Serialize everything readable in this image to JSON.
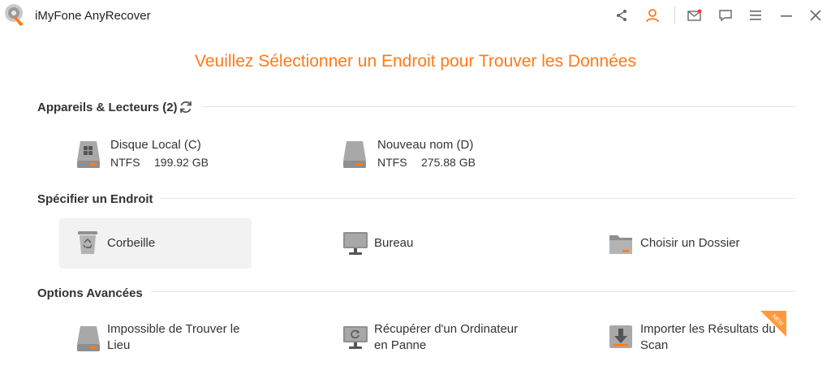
{
  "app": {
    "title": "iMyFone AnyRecover"
  },
  "headline": "Veuillez Sélectionner un Endroit pour Trouver les Données",
  "devices": {
    "title": "Appareils & Lecteurs (2)",
    "drives": [
      {
        "name": "Disque Local (C)",
        "fs": "NTFS",
        "size": "199.92 GB"
      },
      {
        "name": "Nouveau nom (D)",
        "fs": "NTFS",
        "size": "275.88 GB"
      }
    ]
  },
  "locations": {
    "title": "Spécifier un Endroit",
    "items": [
      {
        "label": "Corbeille"
      },
      {
        "label": "Bureau"
      },
      {
        "label": "Choisir un Dossier"
      }
    ]
  },
  "advanced": {
    "title": "Options Avancées",
    "items": [
      {
        "label": "Impossible de Trouver le Lieu"
      },
      {
        "label": "Récupérer d'un Ordinateur en Panne"
      },
      {
        "label": "Importer les Résultats du Scan",
        "badge": "NEW"
      }
    ]
  },
  "colors": {
    "accent": "#ff7a1a",
    "text": "#333333",
    "divider": "#e6e6e6",
    "drive": "#8f8f8f"
  },
  "icons": [
    "share-icon",
    "user-icon",
    "mail-icon",
    "feedback-icon",
    "menu-icon",
    "minimize-icon",
    "close-icon",
    "refresh-icon"
  ]
}
